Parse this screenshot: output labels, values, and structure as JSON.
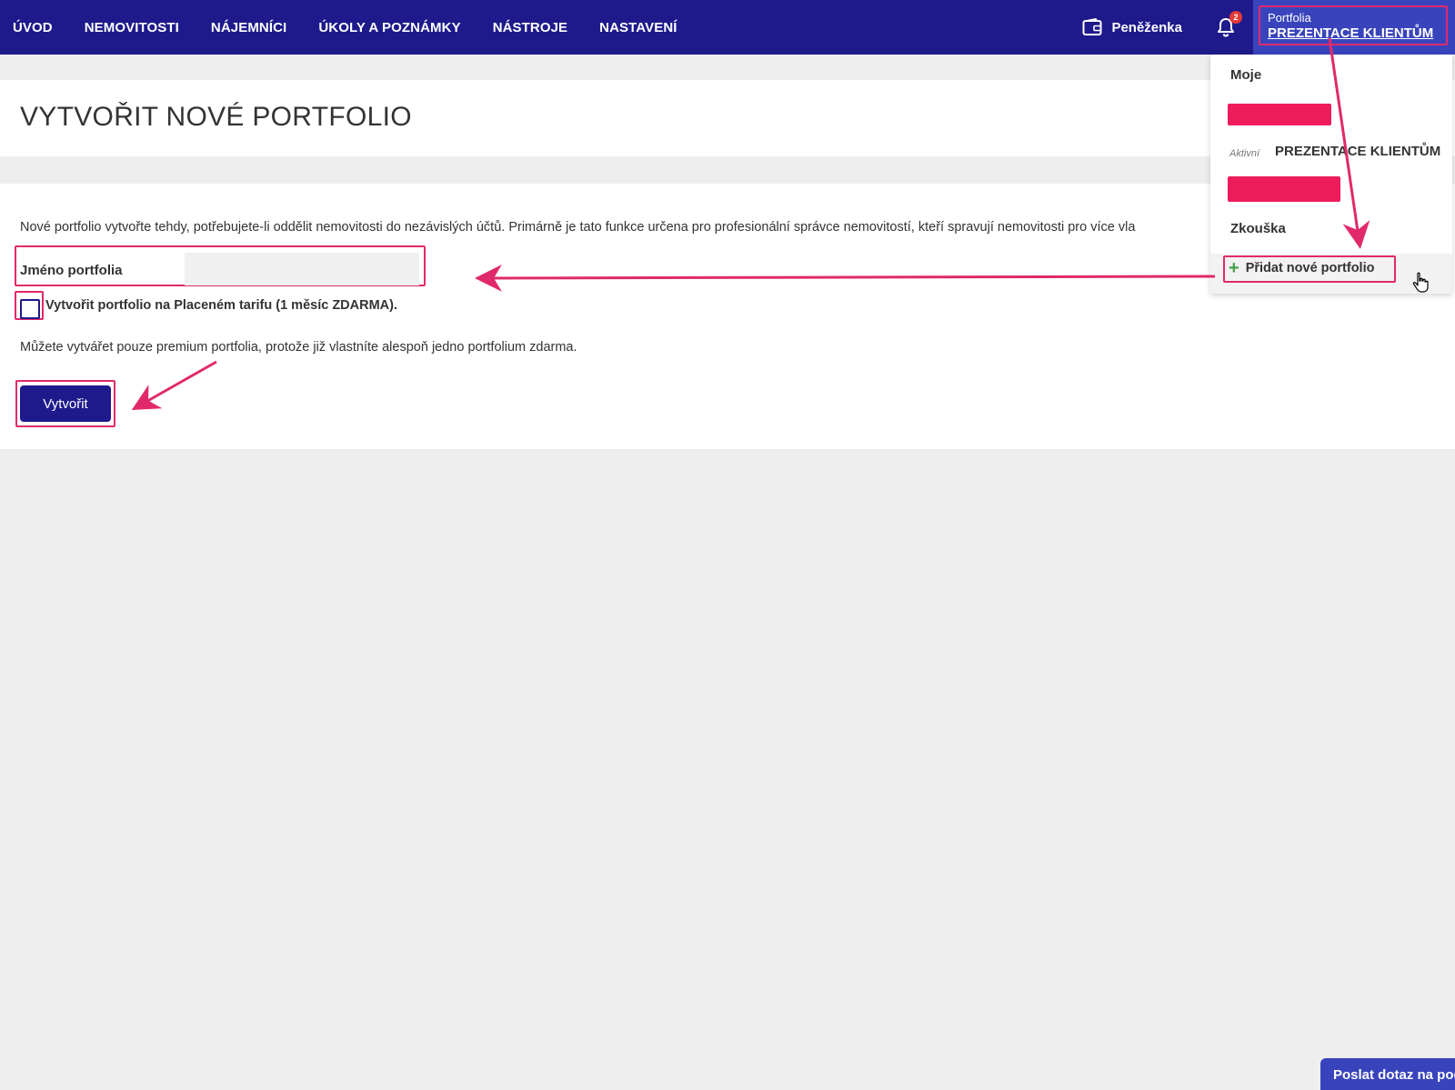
{
  "nav": {
    "items": [
      {
        "label": "ÚVOD",
        "name": "nav-uvod"
      },
      {
        "label": "NEMOVITOSTI",
        "name": "nav-nemovitosti"
      },
      {
        "label": "NÁJEMNÍCI",
        "name": "nav-najemnici"
      },
      {
        "label": "ÚKOLY A POZNÁMKY",
        "name": "nav-ukoly"
      },
      {
        "label": "NÁSTROJE",
        "name": "nav-nastroje"
      },
      {
        "label": "NASTAVENÍ",
        "name": "nav-nastaveni"
      }
    ],
    "wallet_label": "Peněženka",
    "wallet_icon": "wallet-icon",
    "bell_icon": "bell-icon",
    "notification_count": "2",
    "portfolio_label": "Portfolia",
    "portfolio_current": "PREZENTACE KLIENTŮM"
  },
  "page": {
    "title": "VYTVOŘIT NOVÉ PORTFOLIO"
  },
  "form": {
    "description": "Nové portfolio vytvořte tehdy, potřebujete-li oddělit nemovitosti do nezávislých účtů. Primárně je tato funkce určena pro profesionální správce nemovitostí, kteří spravují nemovitosti pro více vla",
    "name_label": "Jméno portfolia",
    "name_value": "",
    "checkbox_label": "Vytvořit portfolio na Placeném tarifu (1 měsíc ZDARMA).",
    "checkbox_checked": false,
    "note": "Můžete vytvářet pouze premium portfolia, protože již vlastníte alespoň jedno portfolium zdarma.",
    "submit_label": "Vytvořit"
  },
  "dropdown": {
    "section_title": "Moje",
    "active_tag": "Aktivní",
    "active_name": "PREZENTACE KLIENTŮM",
    "other_item": "Zkouška",
    "add_label": "Přidat nové portfolio",
    "redaction_color": "#ee1c5c"
  },
  "help": {
    "label": "Poslat dotaz na podporu"
  },
  "colors": {
    "nav_bg": "#1e1a8c",
    "accent": "#3944bc",
    "highlight": "#e0296b",
    "add_plus": "#43a047"
  }
}
